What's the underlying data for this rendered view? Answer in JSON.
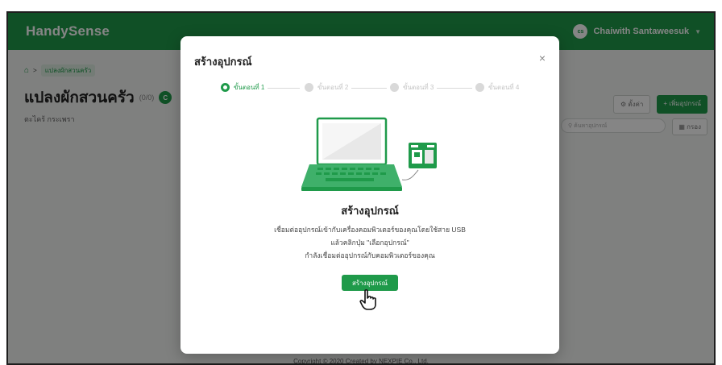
{
  "app": {
    "brand": "HandySense",
    "user_initials": "cs",
    "user_name": "Chaiwith Santaweesuk",
    "accent_color": "#1f9a4a"
  },
  "page": {
    "breadcrumb_home_icon": "home-icon",
    "breadcrumb_item": "แปลงผักสวนครัว",
    "title": "แปลงผักสวนครัว",
    "count": "(0/0)",
    "badge": "C",
    "location": "ตะไคร้ กระเพรา",
    "settings_button": "ตั้งค่า",
    "add_device_button": "+ เพิ่มอุปกรณ์",
    "search_placeholder": "ค้นหาอุปกรณ์",
    "grid_button": "กรอง",
    "footer": "Copyright © 2020 Created by NEXPIE Co., Ltd."
  },
  "modal": {
    "title": "สร้างอุปกรณ์",
    "close": "×",
    "steps": [
      {
        "label": "ขั้นตอนที่ 1",
        "active": true
      },
      {
        "label": "ขั้นตอนที่ 2",
        "active": false
      },
      {
        "label": "ขั้นตอนที่ 3",
        "active": false
      },
      {
        "label": "ขั้นตอนที่ 4",
        "active": false
      }
    ],
    "heading": "สร้างอุปกรณ์",
    "description_lines": [
      "เชื่อมต่ออุปกรณ์เข้ากับเครื่องคอมพิวเตอร์ของคุณโดยใช้สาย USB",
      "แล้วคลิกปุ่ม \"เลือกอุปกรณ์\"",
      "กำลังเชื่อมต่ออุปกรณ์กับคอมพิวเตอร์ของคุณ"
    ],
    "create_button": "สร้างอุปกรณ์",
    "illustration": "laptop-with-device-illustration",
    "cursor": "hand-pointer-icon"
  }
}
